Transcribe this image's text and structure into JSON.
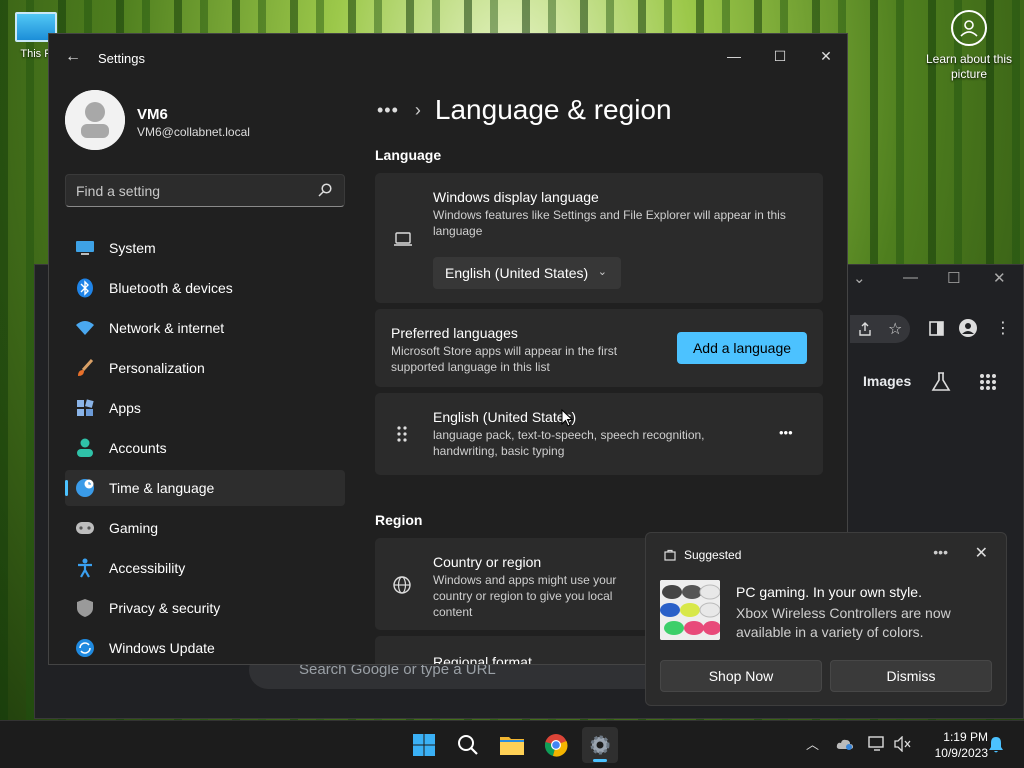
{
  "desktop": {
    "icon_label": "This P",
    "learn_label": "Learn about this picture"
  },
  "chrome": {
    "images_label": "Images",
    "search_placeholder": "Search Google or type a URL"
  },
  "settings": {
    "window_title": "Settings",
    "profile": {
      "name": "VM6",
      "email": "VM6@collabnet.local"
    },
    "search": {
      "placeholder": "Find a setting"
    },
    "nav": [
      {
        "label": "System",
        "icon": "system-icon"
      },
      {
        "label": "Bluetooth & devices",
        "icon": "bluetooth-icon"
      },
      {
        "label": "Network & internet",
        "icon": "wifi-icon"
      },
      {
        "label": "Personalization",
        "icon": "brush-icon"
      },
      {
        "label": "Apps",
        "icon": "apps-icon"
      },
      {
        "label": "Accounts",
        "icon": "person-icon"
      },
      {
        "label": "Time & language",
        "icon": "globe-clock-icon",
        "active": true
      },
      {
        "label": "Gaming",
        "icon": "gamepad-icon"
      },
      {
        "label": "Accessibility",
        "icon": "accessibility-icon"
      },
      {
        "label": "Privacy & security",
        "icon": "shield-icon"
      },
      {
        "label": "Windows Update",
        "icon": "update-icon"
      }
    ],
    "breadcrumb": {
      "overflow": "•••",
      "page_title": "Language & region"
    },
    "language_section": {
      "heading": "Language",
      "display_language": {
        "title": "Windows display language",
        "description": "Windows features like Settings and File Explorer will appear in this language",
        "selected": "English (United States)"
      },
      "preferred": {
        "title": "Preferred languages",
        "description": "Microsoft Store apps will appear in the first supported language in this list",
        "add_button": "Add a language"
      },
      "installed": {
        "title": "English (United States)",
        "description": "language pack, text-to-speech, speech recognition, handwriting, basic typing",
        "more": "•••"
      }
    },
    "region_section": {
      "heading": "Region",
      "country": {
        "title": "Country or region",
        "description": "Windows and apps might use your country or region to give you local content"
      },
      "format": {
        "title": "Regional format"
      }
    }
  },
  "notification": {
    "header": "Suggested",
    "more": "•••",
    "title": "PC gaming. In your own style.",
    "body": "Xbox Wireless Controllers are now available in a variety of colors.",
    "primary_button": "Shop Now",
    "secondary_button": "Dismiss"
  },
  "taskbar": {
    "time": "1:19 PM",
    "date": "10/9/2023"
  },
  "colors": {
    "accent": "#4cc2ff",
    "window_bg": "#202020",
    "card_bg": "#2b2b2b"
  }
}
